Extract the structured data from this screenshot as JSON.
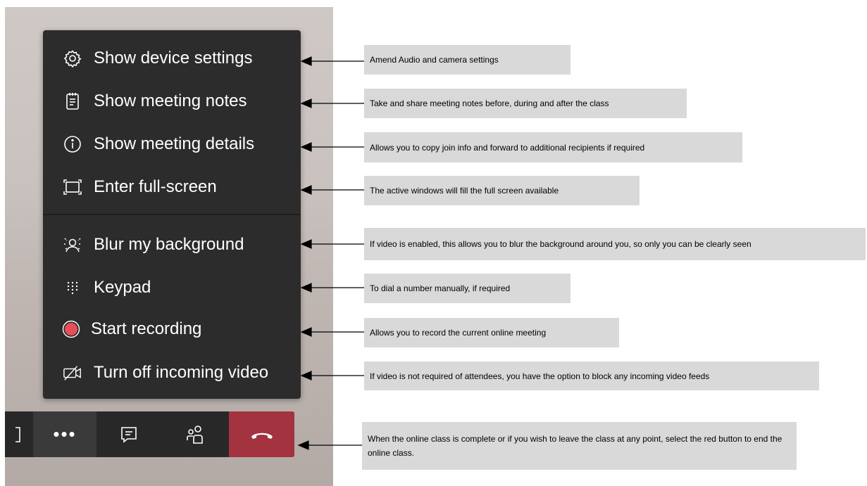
{
  "menu": {
    "items": [
      {
        "label": "Show device settings",
        "icon": "gear-icon"
      },
      {
        "label": "Show meeting notes",
        "icon": "notes-icon"
      },
      {
        "label": "Show meeting details",
        "icon": "info-icon"
      },
      {
        "label": "Enter full-screen",
        "icon": "fullscreen-icon"
      },
      {
        "label": "Blur my background",
        "icon": "blur-background-icon"
      },
      {
        "label": "Keypad",
        "icon": "keypad-icon"
      },
      {
        "label": "Start recording",
        "icon": "record-icon"
      },
      {
        "label": "Turn off incoming video",
        "icon": "video-off-icon"
      }
    ]
  },
  "toolbar": {
    "more_label": "•••",
    "colors": {
      "hangup": "#a2333f",
      "background": "#292828",
      "active": "#3b3a3a"
    }
  },
  "callouts": [
    "Amend Audio and camera settings",
    "Take and share meeting notes before, during and after the class",
    "Allows you to copy join info and forward to additional recipients if required",
    "The active windows will fill the full screen available",
    "If video is enabled, this allows you to blur the background around you, so only you can be clearly seen",
    "To dial a number manually, if required",
    "Allows you to record the current online meeting",
    "If video is not required of attendees, you have the option to block any incoming video feeds",
    "When the online class is complete or if you wish to leave the class at any point, select the red button to end the online class."
  ],
  "colors": {
    "menu_bg": "#2d2c2c",
    "callout_bg": "#d9d9d9",
    "record_red": "#e84e57"
  }
}
